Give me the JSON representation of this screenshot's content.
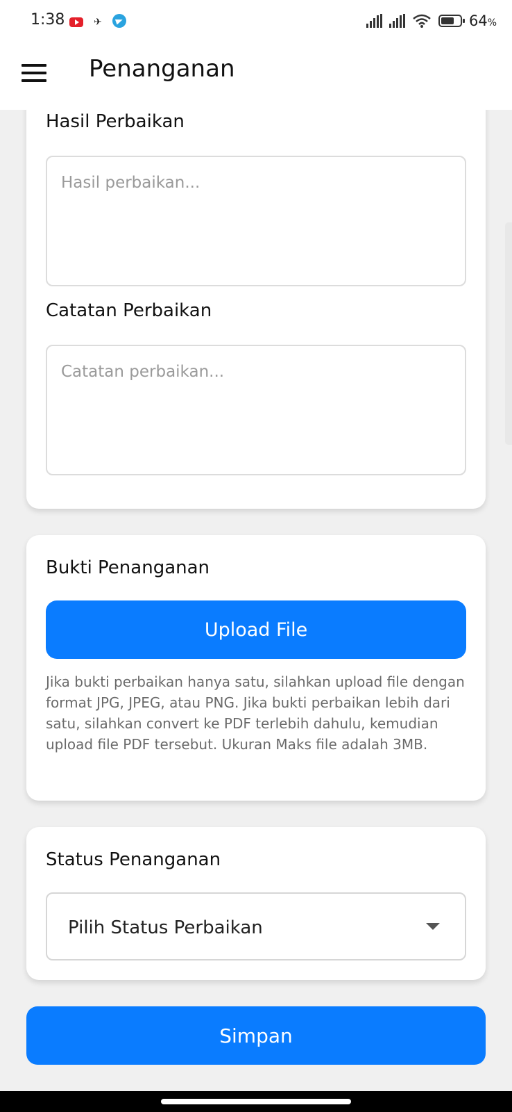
{
  "status_bar": {
    "time": "1:38",
    "battery_percent": "64",
    "battery_unit": "%",
    "icons": [
      "youtube-icon",
      "misc-notification-icon",
      "telegram-icon",
      "signal-icon",
      "signal-icon",
      "wifi-icon",
      "battery-icon"
    ]
  },
  "appbar": {
    "title": "Penanganan",
    "menu_icon": "hamburger-menu-icon"
  },
  "form": {
    "hasil": {
      "label": "Hasil Perbaikan",
      "placeholder": "Hasil perbaikan...",
      "value": ""
    },
    "catatan": {
      "label": "Catatan Perbaikan",
      "placeholder": "Catatan perbaikan...",
      "value": ""
    },
    "bukti": {
      "label": "Bukti Penanganan",
      "upload_label": "Upload File",
      "help": "Jika bukti perbaikan hanya satu, silahkan upload file dengan format JPG, JPEG, atau PNG. Jika bukti perbaikan lebih dari satu, silahkan convert ke PDF terlebih dahulu, kemudian upload file PDF tersebut. Ukuran Maks file adalah 3MB."
    },
    "status": {
      "label": "Status Penanganan",
      "selected": "Pilih Status Perbaikan"
    },
    "save_label": "Simpan"
  },
  "colors": {
    "primary": "#0a7cff",
    "background": "#f0f0f0",
    "card": "#ffffff",
    "placeholder": "#9a9a9a",
    "help_text": "#6a6a6a"
  }
}
